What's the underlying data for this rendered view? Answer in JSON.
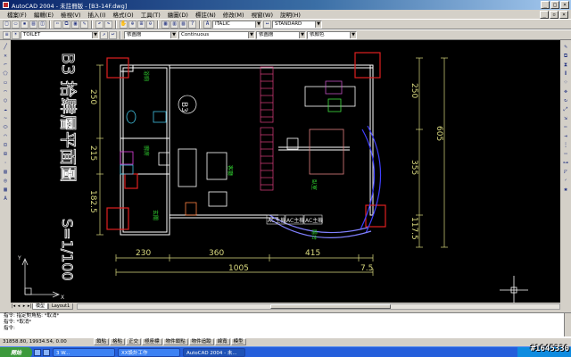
{
  "window": {
    "title": "AutoCAD 2004 - 未註冊版 - [B3-14F.dwg]"
  },
  "menu": [
    "檔案(F)",
    "編輯(E)",
    "檢視(V)",
    "插入(I)",
    "格式(O)",
    "工具(T)",
    "繪圖(D)",
    "標註(N)",
    "修改(M)",
    "視窗(W)",
    "說明(H)"
  ],
  "toolbar": {
    "text_style": "ITALIC",
    "dim_style": "STANDARD"
  },
  "props": {
    "layer": "TOILET",
    "color": "依圖層",
    "linetype": "Continuous",
    "lineweight": "依圖層",
    "plotstyle": "依顏色"
  },
  "drawing": {
    "title_vertical": "B3 拾肆層平面圖",
    "scale": "S=1/100",
    "unit_label": "B3",
    "dims_bottom": [
      "230",
      "360",
      "415"
    ],
    "dim_total": "1005",
    "dim_small": "7.5",
    "dims_left": [
      "250",
      "215",
      "182.5"
    ],
    "dims_right": [
      "250",
      "355",
      "117.5"
    ],
    "dim_right_total": "605",
    "rooms": {
      "toilet": "浴廁",
      "kitchen": "廚房",
      "living": "客廳",
      "bedroom": "臥室",
      "balcony": "陽台",
      "entry": "玄關"
    },
    "ac_labels": [
      "AC主機",
      "AC主機",
      "AC主機"
    ]
  },
  "layout_tabs": [
    "模型",
    "Layout1"
  ],
  "command": {
    "line1": "指令:  指定對角點:  *取消*",
    "line2": "指令:  *取消*",
    "line3": "指令:"
  },
  "status": {
    "coords": "31858.80, 19934.54, 0.00",
    "buttons": [
      "鎖點",
      "格點",
      "正交",
      "極座標",
      "物件鎖點",
      "物件追蹤",
      "線寬",
      "模型"
    ]
  },
  "taskbar": {
    "start": "開始",
    "tasks": [
      "3 W...",
      "XX設計工作",
      "AutoCAD 2004 - 未..."
    ],
    "watermark": "#1645330"
  }
}
